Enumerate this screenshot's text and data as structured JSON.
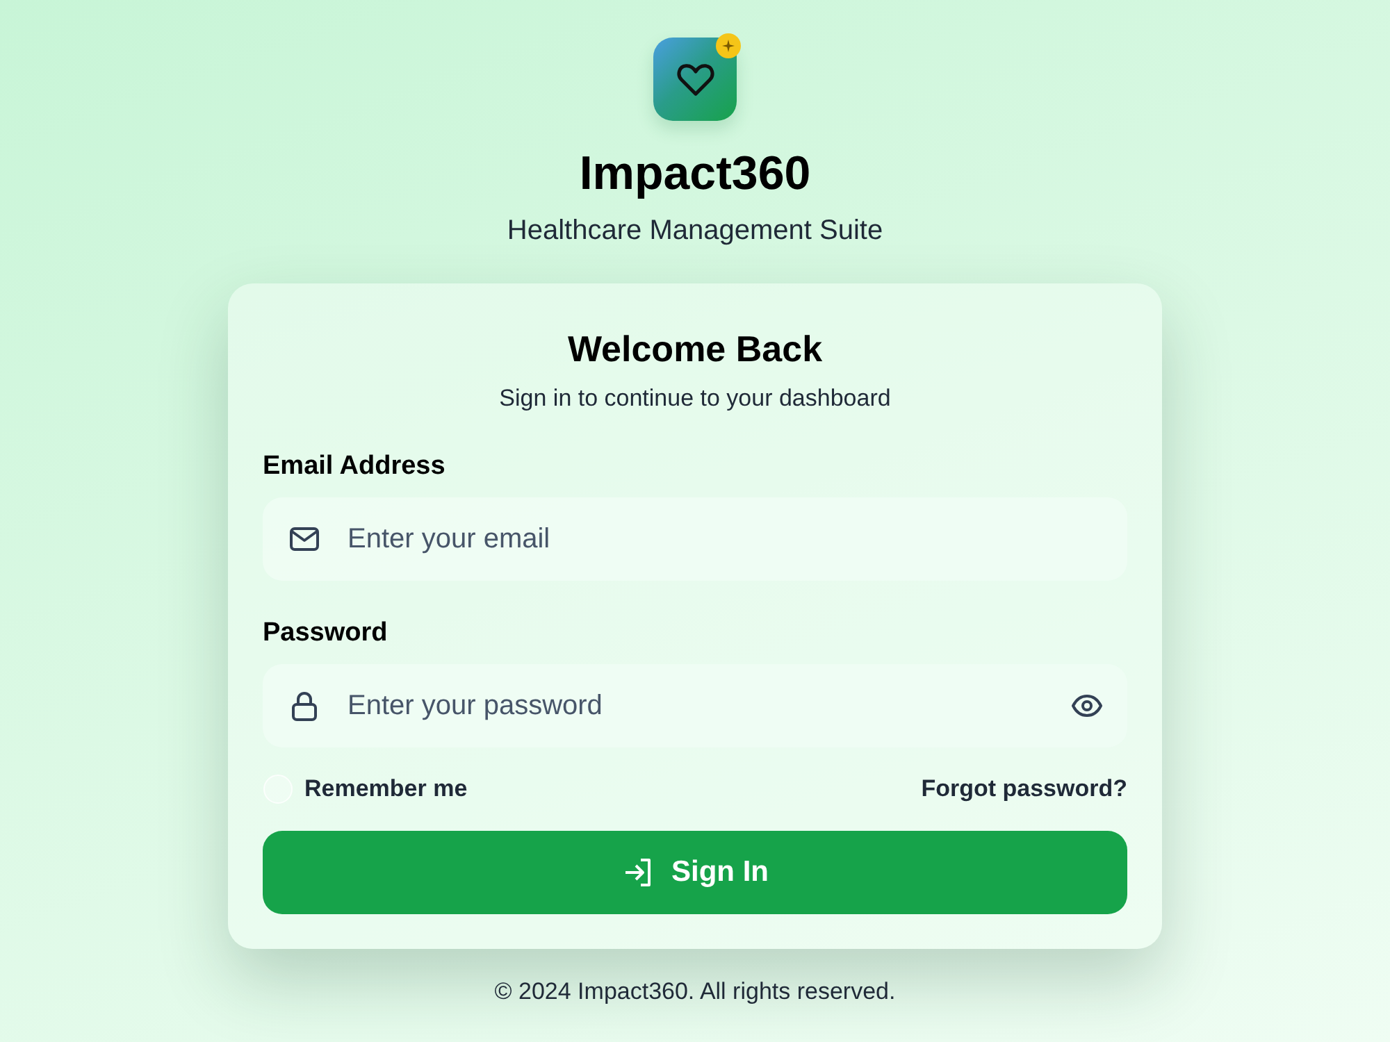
{
  "logo": {
    "name": "Impact360",
    "tagline": "Healthcare Management Suite"
  },
  "card": {
    "title": "Welcome Back",
    "subtitle": "Sign in to continue to your dashboard",
    "fields": [
      {
        "kind": "email",
        "label": "Email Address",
        "placeholder": "Enter your email"
      },
      {
        "kind": "password",
        "label": "Password",
        "placeholder": "Enter your password"
      }
    ],
    "remember": {
      "label": "Remember me",
      "checked": false
    },
    "forgot_link": "Forgot password?",
    "submit_button": "Sign In"
  },
  "footer": "© 2024 Impact360. All rights reserved."
}
